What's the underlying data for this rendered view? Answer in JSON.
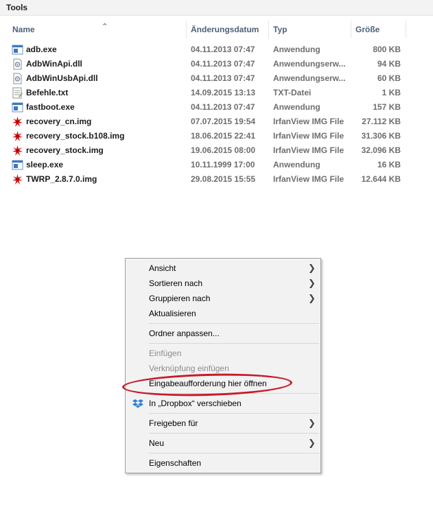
{
  "window": {
    "title": "Tools"
  },
  "columns": {
    "name": "Name",
    "date": "Änderungsdatum",
    "type": "Typ",
    "size": "Größe"
  },
  "files": [
    {
      "name": "adb.exe",
      "date": "04.11.2013 07:47",
      "type": "Anwendung",
      "size": "800 KB",
      "icon": "exe-icon"
    },
    {
      "name": "AdbWinApi.dll",
      "date": "04.11.2013 07:47",
      "type": "Anwendungserw...",
      "size": "94 KB",
      "icon": "dll-icon"
    },
    {
      "name": "AdbWinUsbApi.dll",
      "date": "04.11.2013 07:47",
      "type": "Anwendungserw...",
      "size": "60 KB",
      "icon": "dll-icon"
    },
    {
      "name": "Befehle.txt",
      "date": "14.09.2015 13:13",
      "type": "TXT-Datei",
      "size": "1 KB",
      "icon": "txt-icon"
    },
    {
      "name": "fastboot.exe",
      "date": "04.11.2013 07:47",
      "type": "Anwendung",
      "size": "157 KB",
      "icon": "exe-icon"
    },
    {
      "name": "recovery_cn.img",
      "date": "07.07.2015 19:54",
      "type": "IrfanView IMG File",
      "size": "27.112 KB",
      "icon": "img-icon"
    },
    {
      "name": "recovery_stock.b108.img",
      "date": "18.06.2015 22:41",
      "type": "IrfanView IMG File",
      "size": "31.306 KB",
      "icon": "img-icon"
    },
    {
      "name": "recovery_stock.img",
      "date": "19.06.2015 08:00",
      "type": "IrfanView IMG File",
      "size": "32.096 KB",
      "icon": "img-icon"
    },
    {
      "name": "sleep.exe",
      "date": "10.11.1999 17:00",
      "type": "Anwendung",
      "size": "16 KB",
      "icon": "exe-icon"
    },
    {
      "name": "TWRP_2.8.7.0.img",
      "date": "29.08.2015 15:55",
      "type": "IrfanView IMG File",
      "size": "12.644 KB",
      "icon": "img-icon"
    }
  ],
  "context_menu": {
    "ansicht": "Ansicht",
    "sortieren": "Sortieren nach",
    "gruppieren": "Gruppieren nach",
    "aktualisieren": "Aktualisieren",
    "ordner_anpassen": "Ordner anpassen...",
    "einfuegen": "Einfügen",
    "verknuepfung": "Verknüpfung einfügen",
    "eingabeaufforderung": "Eingabeaufforderung hier öffnen",
    "dropbox": "In „Dropbox“ verschieben",
    "freigeben": "Freigeben für",
    "neu": "Neu",
    "eigenschaften": "Eigenschaften"
  },
  "colors": {
    "highlight_ellipse": "#c81a28",
    "header_text": "#4c607a"
  }
}
